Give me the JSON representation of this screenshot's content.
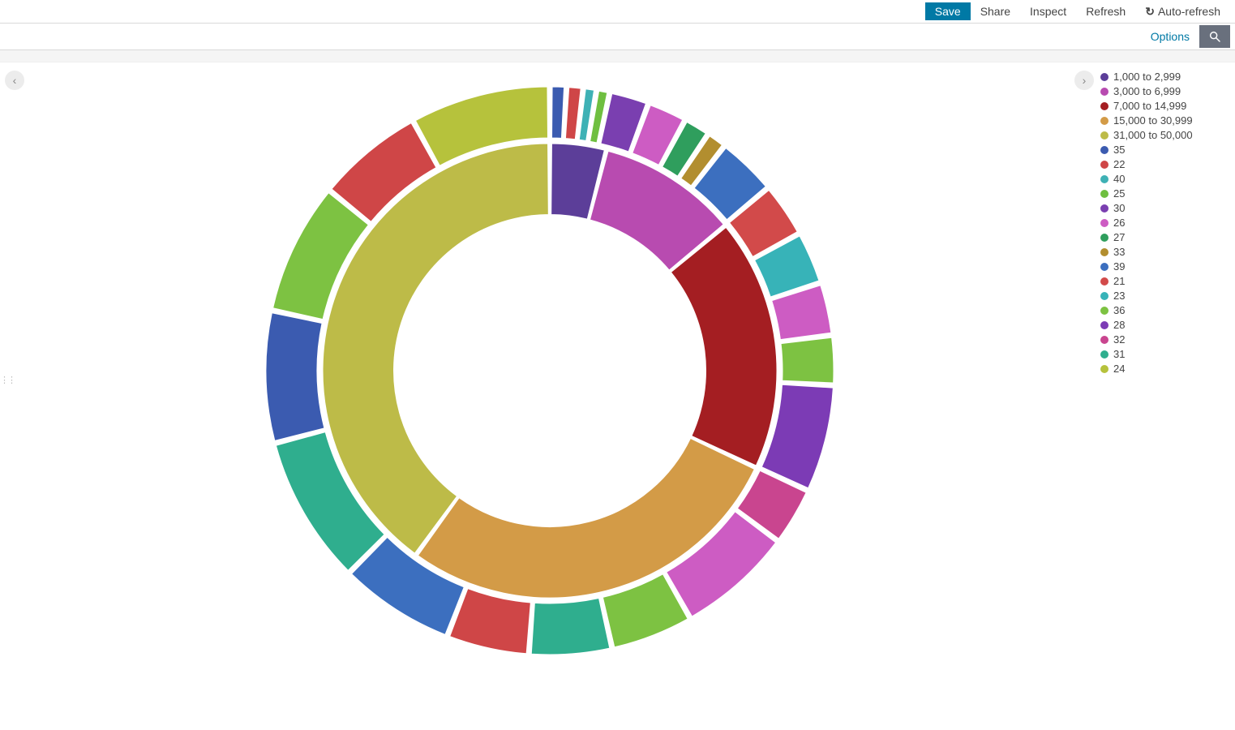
{
  "toolbar": {
    "save_label": "Save",
    "share_label": "Share",
    "inspect_label": "Inspect",
    "refresh_label": "Refresh",
    "autorefresh_label": "Auto-refresh"
  },
  "subtoolbar": {
    "options_label": "Options",
    "search_icon": "search-icon"
  },
  "legend": [
    {
      "label": "1,000 to 2,999",
      "color": "#5c3e99"
    },
    {
      "label": "3,000 to 6,999",
      "color": "#b84bb0"
    },
    {
      "label": "7,000 to 14,999",
      "color": "#a41e22"
    },
    {
      "label": "15,000 to 30,999",
      "color": "#d39b47"
    },
    {
      "label": "31,000 to 50,000",
      "color": "#bdbb48"
    },
    {
      "label": "35",
      "color": "#3b5bb0"
    },
    {
      "label": "22",
      "color": "#cf4647"
    },
    {
      "label": "40",
      "color": "#3eb1b5"
    },
    {
      "label": "25",
      "color": "#6fbf40"
    },
    {
      "label": "30",
      "color": "#7a3fb0"
    },
    {
      "label": "26",
      "color": "#cd5cc3"
    },
    {
      "label": "27",
      "color": "#2f9e5d"
    },
    {
      "label": "33",
      "color": "#b28e2f"
    },
    {
      "label": "39",
      "color": "#3c6fbf"
    },
    {
      "label": "21",
      "color": "#d24a4a"
    },
    {
      "label": "23",
      "color": "#37b3b8"
    },
    {
      "label": "36",
      "color": "#7dc242"
    },
    {
      "label": "28",
      "color": "#7c3bb5"
    },
    {
      "label": "32",
      "color": "#c9458f"
    },
    {
      "label": "31",
      "color": "#2fae8e"
    },
    {
      "label": "24",
      "color": "#b6c23c"
    }
  ],
  "chart_data": {
    "type": "pie",
    "subtype": "nested-donut",
    "title": "",
    "rings": [
      {
        "name": "inner",
        "inner_radius": 0.55,
        "outer_radius": 0.8,
        "slices": [
          {
            "label": "1,000 to 2,999",
            "value": 4,
            "color": "#5c3e99"
          },
          {
            "label": "3,000 to 6,999",
            "value": 10,
            "color": "#b84bb0"
          },
          {
            "label": "7,000 to 14,999",
            "value": 18,
            "color": "#a41e22"
          },
          {
            "label": "15,000 to 30,999",
            "value": 28,
            "color": "#d39b47"
          },
          {
            "label": "31,000 to 50,000",
            "value": 40,
            "color": "#bdbb48"
          }
        ]
      },
      {
        "name": "outer",
        "inner_radius": 0.82,
        "outer_radius": 1.0,
        "slices": [
          {
            "label": "35",
            "value": 1.0,
            "color": "#3b5bb0"
          },
          {
            "label": "22",
            "value": 1.0,
            "color": "#cf4647"
          },
          {
            "label": "40",
            "value": 0.8,
            "color": "#3eb1b5"
          },
          {
            "label": "25",
            "value": 0.8,
            "color": "#6fbf40"
          },
          {
            "label": "30",
            "value": 2.4,
            "color": "#7a3fb0"
          },
          {
            "label": "26",
            "value": 2.4,
            "color": "#cd5cc3"
          },
          {
            "label": "27",
            "value": 1.6,
            "color": "#2f9e5d"
          },
          {
            "label": "33",
            "value": 1.2,
            "color": "#b28e2f"
          },
          {
            "label": "39",
            "value": 3.6,
            "color": "#3c6fbf"
          },
          {
            "label": "21",
            "value": 3.3,
            "color": "#d24a4a"
          },
          {
            "label": "23",
            "value": 3.2,
            "color": "#37b3b8"
          },
          {
            "label": "26",
            "value": 3.2,
            "color": "#cd5cc3"
          },
          {
            "label": "36",
            "value": 3.0,
            "color": "#7dc242"
          },
          {
            "label": "28",
            "value": 6.5,
            "color": "#7c3bb5"
          },
          {
            "label": "32",
            "value": 3.5,
            "color": "#c9458f"
          },
          {
            "label": "26",
            "value": 7.0,
            "color": "#cd5cc3"
          },
          {
            "label": "36",
            "value": 5.0,
            "color": "#7dc242"
          },
          {
            "label": "31",
            "value": 5.0,
            "color": "#2fae8e"
          },
          {
            "label": "22",
            "value": 5.0,
            "color": "#cf4647"
          },
          {
            "label": "39",
            "value": 7.0,
            "color": "#3c6fbf"
          },
          {
            "label": "31",
            "value": 9.0,
            "color": "#2fae8e"
          },
          {
            "label": "35",
            "value": 8.0,
            "color": "#3b5bb0"
          },
          {
            "label": "36",
            "value": 8.0,
            "color": "#7dc242"
          },
          {
            "label": "22",
            "value": 6.5,
            "color": "#cf4647"
          },
          {
            "label": "24",
            "value": 8.5,
            "color": "#b6c23c"
          }
        ]
      }
    ]
  }
}
